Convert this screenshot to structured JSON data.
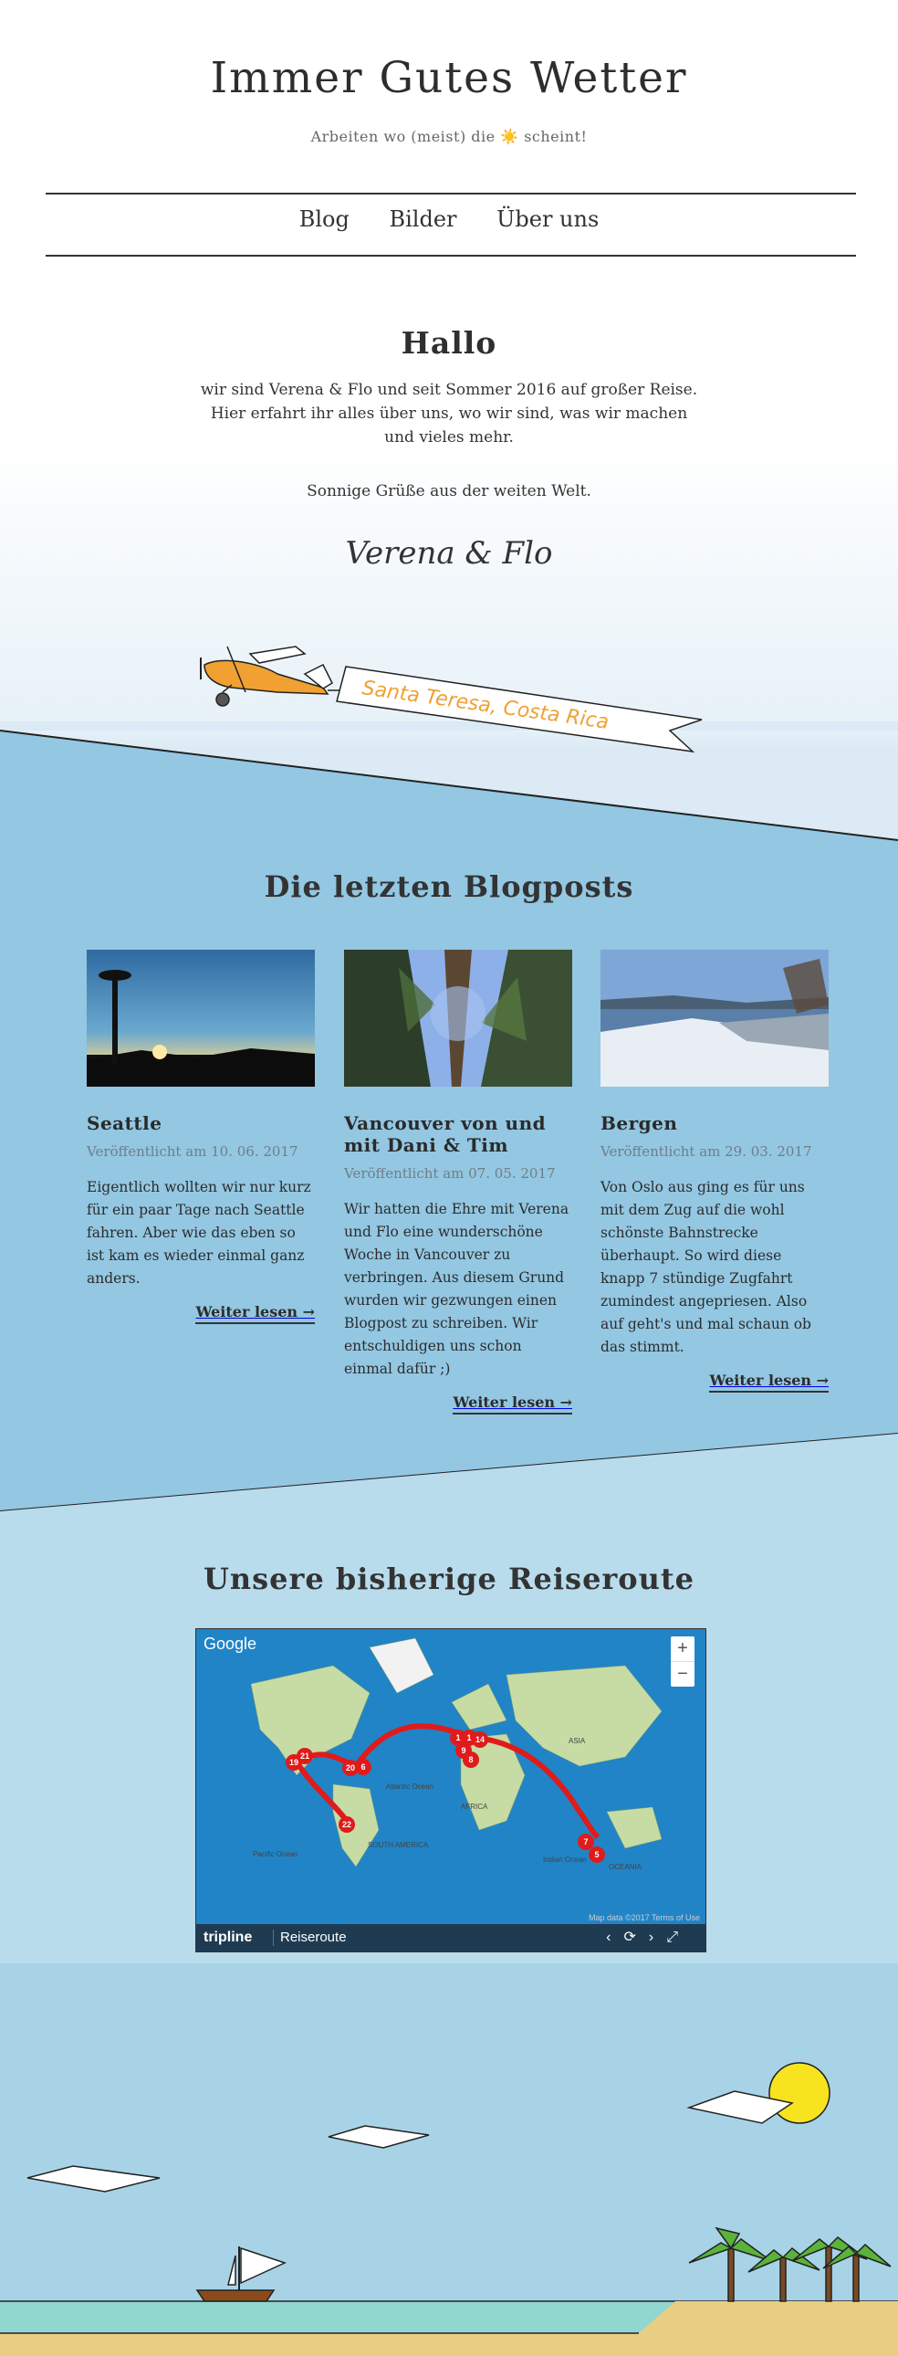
{
  "site": {
    "title": "Immer Gutes Wetter",
    "tagline_pre": "Arbeiten wo (meist) die",
    "tagline_icon": "☀️",
    "tagline_post": "scheint!"
  },
  "nav": {
    "items": [
      "Blog",
      "Bilder",
      "Über uns"
    ]
  },
  "intro": {
    "title": "Hallo",
    "text": "wir sind Verena & Flo und seit Sommer 2016 auf großer Reise. Hier erfahrt ihr alles über uns, wo wir sind, was wir machen und vieles mehr.",
    "greeting": "Sonnige Grüße aus der weiten Welt.",
    "signature": "Verena & Flo"
  },
  "banner": {
    "location": "Santa Teresa, Costa Rica"
  },
  "blog": {
    "title": "Die letzten Blogposts",
    "posts": [
      {
        "title": "Seattle",
        "meta": "Veröffentlicht am 10. 06. 2017",
        "excerpt": "Eigentlich wollten wir nur kurz für ein paar Tage nach Seattle fahren. Aber wie das eben so ist kam es wieder einmal ganz anders.",
        "more": "Weiter lesen →"
      },
      {
        "title": "Vancouver von und mit Dani & Tim",
        "meta": "Veröffentlicht am 07. 05. 2017",
        "excerpt": "Wir hatten die Ehre mit Verena und Flo eine wunderschöne Woche in Vancouver zu verbringen. Aus diesem Grund wurden wir gezwungen einen Blogpost zu schreiben. Wir entschuldigen uns schon einmal dafür ;)",
        "more": "Weiter lesen →"
      },
      {
        "title": "Bergen",
        "meta": "Veröffentlicht am 29. 03. 2017",
        "excerpt": "Von Oslo aus ging es für uns mit dem Zug auf die wohl schönste Bahnstrecke überhaupt. So wird diese knapp 7 stündige Zugfahrt zumindest angepriesen. Also auf geht's und mal schaun ob das stimmt.",
        "more": "Weiter lesen →"
      }
    ]
  },
  "route": {
    "title": "Unsere bisherige Reiseroute",
    "map_logo": "Google",
    "zoom_in": "+",
    "zoom_out": "−",
    "brand": "tripline",
    "label": "Reiseroute",
    "attribution": "Map data ©2017 Terms of Use",
    "region_labels": [
      "ASIA",
      "AFRICA",
      "SOUTH AMERICA",
      "OCEANIA",
      "Atlantic Ocean",
      "Pacific Ocean",
      "Indian Ocean"
    ],
    "markers": [
      "1",
      "1",
      "14",
      "9",
      "8",
      "19",
      "21",
      "20",
      "6",
      "22",
      "7",
      "5"
    ]
  },
  "colors": {
    "band_blue": "#93c7e2",
    "sky_blue": "#b6dbec",
    "sand": "#e8cd82",
    "sea": "#8fd7cf",
    "sun": "#f8e31f",
    "route_red": "#e01b1b"
  }
}
